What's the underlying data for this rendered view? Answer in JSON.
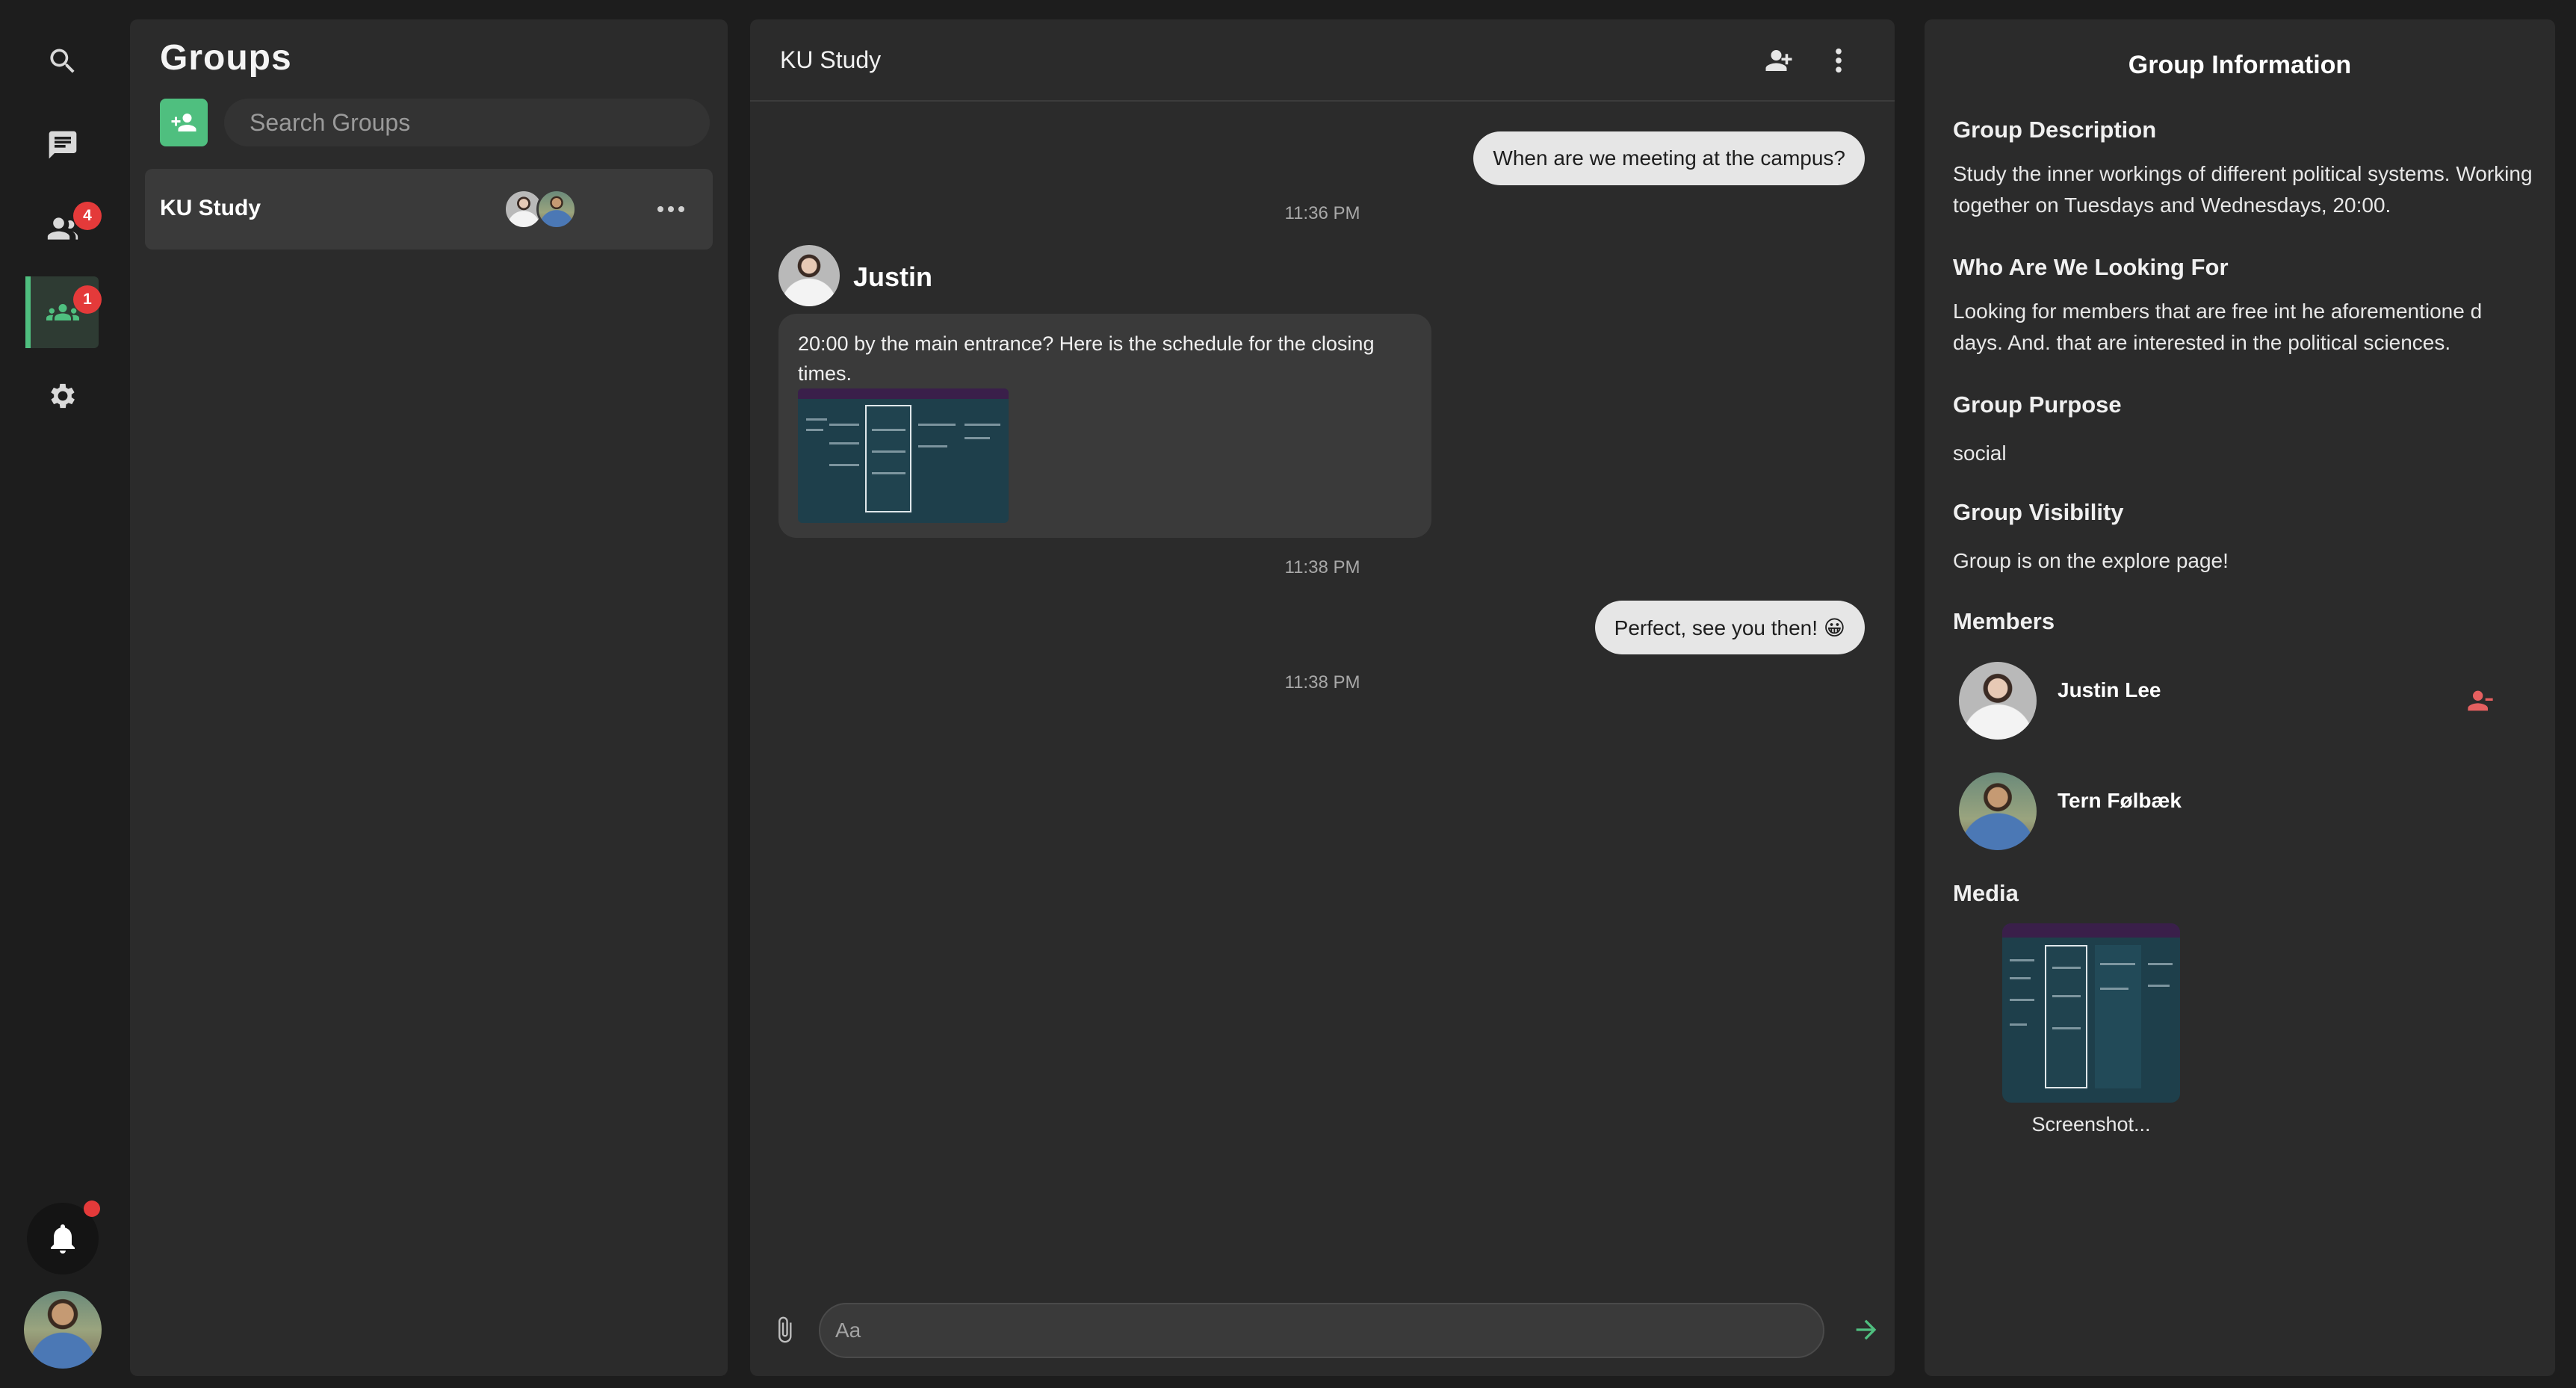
{
  "rail": {
    "nav": [
      {
        "name": "search",
        "icon": "search-icon"
      },
      {
        "name": "chats",
        "icon": "chat-icon"
      },
      {
        "name": "friends",
        "icon": "users-icon",
        "badge": "4"
      },
      {
        "name": "groups",
        "icon": "group-icon",
        "badge": "1",
        "active": true
      },
      {
        "name": "settings",
        "icon": "gear-icon"
      }
    ],
    "notifications_icon": "bell-icon",
    "accent": "#4fbf7f",
    "badge_color": "#e43a3a"
  },
  "groups": {
    "title": "Groups",
    "search_placeholder": "Search Groups",
    "list": [
      {
        "name": "KU Study"
      }
    ]
  },
  "chat": {
    "title": "KU Study",
    "messages": [
      {
        "direction": "out",
        "text": "When are we meeting at the campus?",
        "time": "11:36 PM"
      },
      {
        "direction": "in",
        "sender": "Justin",
        "text": "20:00 by the main entrance? Here is the schedule for the closing times.",
        "attachment": "screenshot",
        "time": "11:38 PM"
      },
      {
        "direction": "out",
        "text": "Perfect, see you then! 😀",
        "time": "11:38 PM"
      }
    ],
    "input_placeholder": "Aa"
  },
  "info": {
    "title": "Group Information",
    "description_heading": "Group Description",
    "description": "Study the inner workings of different political systems. Working together on Tuesdays and Wednesdays, 20:00.",
    "looking_for_heading": "Who Are We Looking For",
    "looking_for": "Looking for members that are free int he aforementione d days. And. that are interested in the political sciences.",
    "purpose_heading": "Group Purpose",
    "purpose": "social",
    "visibility_heading": "Group Visibility",
    "visibility": "Group is on the explore page!",
    "members_heading": "Members",
    "members": [
      {
        "name": "Justin Lee",
        "removable": true
      },
      {
        "name": "Tern Følbæk",
        "removable": false
      }
    ],
    "media_heading": "Media",
    "media": [
      {
        "caption": "Screenshot..."
      }
    ]
  }
}
